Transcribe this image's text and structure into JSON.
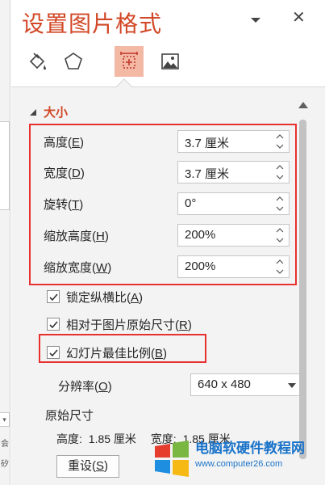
{
  "pane": {
    "title": "设置图片格式",
    "tabs": [
      {
        "name": "fill-line-icon",
        "active": false
      },
      {
        "name": "effects-icon",
        "active": false
      },
      {
        "name": "size-properties-icon",
        "active": true
      },
      {
        "name": "picture-icon",
        "active": false
      }
    ]
  },
  "size_section": {
    "header": "大小",
    "fields": [
      {
        "label": "高度",
        "key": "E",
        "value": "3.7 厘米"
      },
      {
        "label": "宽度",
        "key": "D",
        "value": "3.7 厘米"
      },
      {
        "label": "旋转",
        "key": "T",
        "value": "0°"
      },
      {
        "label": "缩放高度",
        "key": "H",
        "value": "200%"
      },
      {
        "label": "缩放宽度",
        "key": "W",
        "value": "200%"
      }
    ],
    "checks": [
      {
        "label": "锁定纵横比",
        "key": "A",
        "checked": true
      },
      {
        "label": "相对于图片原始尺寸",
        "key": "R",
        "checked": true
      },
      {
        "label": "幻灯片最佳比例",
        "key": "B",
        "checked": true
      }
    ],
    "resolution": {
      "label": "分辨率",
      "key": "O",
      "value": "640 x 480"
    },
    "original": {
      "label": "原始尺寸",
      "height_label": "高度:",
      "height_value": "1.85 厘米",
      "width_label": "宽度:",
      "width_value": "1.85 厘米"
    },
    "reset": {
      "label": "重设",
      "key": "S"
    }
  },
  "watermark": {
    "title": "电脑软硬件教程网",
    "url": "www.computer26.com"
  },
  "colors": {
    "accent": "#d24726",
    "highlight_box": "#e8312f",
    "active_tab": "#f4b9a5",
    "watermark_blue": "#1a73c9"
  }
}
